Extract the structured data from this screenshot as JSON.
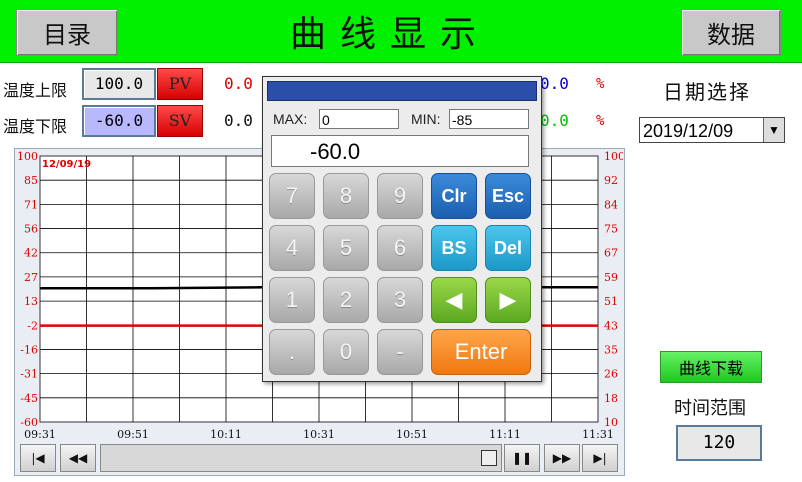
{
  "header": {
    "menu_button": "目录",
    "title": "曲线显示",
    "data_button": "数据",
    "bg_color": "#00f000"
  },
  "controls": {
    "temp_upper_label": "温度上限",
    "temp_upper_value": "100.0",
    "temp_lower_label": "温度下限",
    "temp_lower_value": "-60.0",
    "pv_label": "PV",
    "sv_label": "SV",
    "pv_value": "0.0",
    "sv_value": "0.0",
    "pv_value_right": "0.0",
    "sv_value_right": "0.0",
    "percent1": "%",
    "percent2": "%"
  },
  "keypad": {
    "max_label": "MAX:",
    "max_value": "0",
    "min_label": "MIN:",
    "min_value": "-85",
    "display_value": "-60.0",
    "keys": {
      "k7": "7",
      "k8": "8",
      "k9": "9",
      "clr": "Clr",
      "esc": "Esc",
      "k4": "4",
      "k5": "5",
      "k6": "6",
      "bs": "BS",
      "del": "Del",
      "k1": "1",
      "k2": "2",
      "k3": "3",
      "left": "◀",
      "right": "▶",
      "dot": ".",
      "k0": "0",
      "minus": "-",
      "enter": "Enter"
    }
  },
  "right_panel": {
    "date_label": "日期选择",
    "date_value": "2019/12/09",
    "download_button": "曲线下载",
    "range_label": "时间范围",
    "range_value": "120"
  },
  "chart_data": {
    "type": "line",
    "date_label": "12/09/19",
    "left_axis_ticks": [
      "100",
      "85",
      "71",
      "56",
      "42",
      "27",
      "13",
      "-2",
      "-16",
      "-31",
      "-45",
      "-60"
    ],
    "right_axis_ticks": [
      "100",
      "92",
      "84",
      "75",
      "67",
      "59",
      "51",
      "43",
      "35",
      "26",
      "18",
      "10"
    ],
    "x_ticks": [
      "09:31",
      "09:51",
      "10:11",
      "10:31",
      "10:51",
      "11:11",
      "11:31"
    ],
    "left_ylim": [
      -60,
      100
    ],
    "right_ylim": [
      10,
      100
    ],
    "grid": true,
    "series": [
      {
        "color": "#000000",
        "axis": "left",
        "values": [
          20.5,
          20.5,
          21.0,
          21.0,
          21.0,
          21.0
        ]
      },
      {
        "color": "#e00000",
        "axis": "left",
        "values": [
          -2,
          -2,
          -2,
          -2,
          -2,
          -2
        ]
      }
    ]
  },
  "scrollbar": {
    "first": "|◀",
    "prev": "◀◀",
    "pause": "❚❚",
    "next": "▶▶",
    "last": "▶|"
  }
}
